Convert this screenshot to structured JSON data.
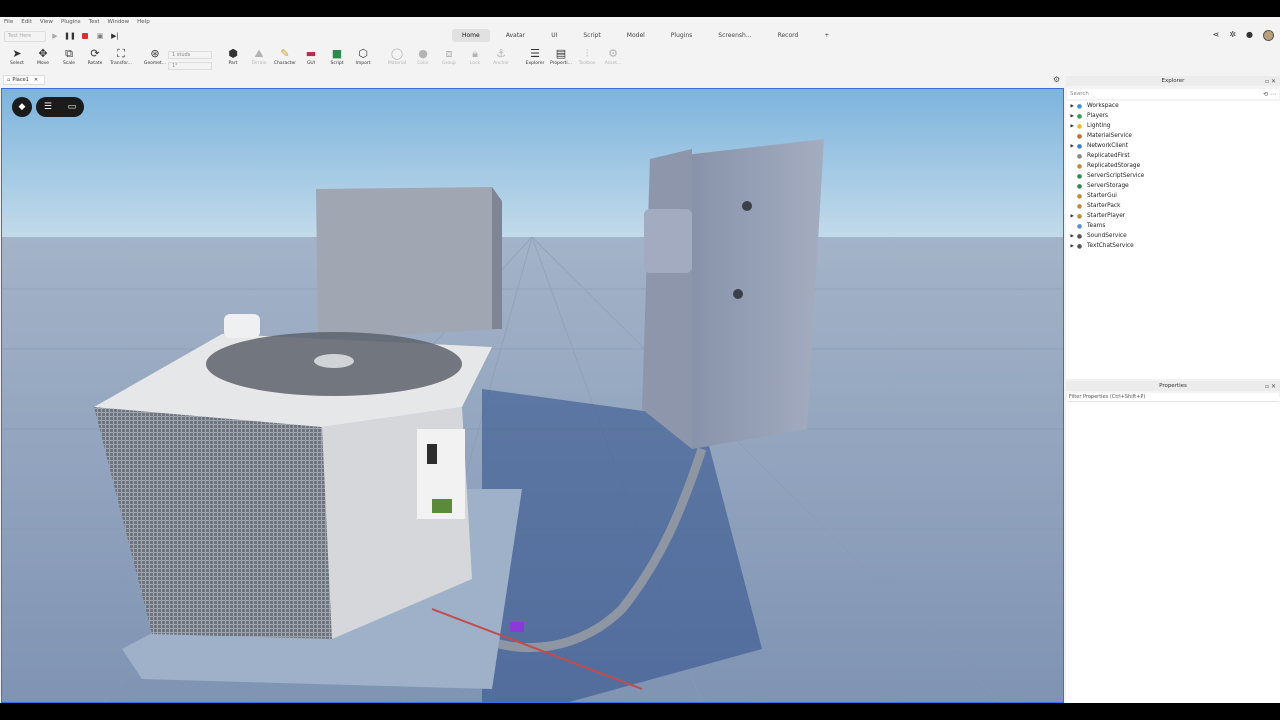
{
  "menu": [
    "File",
    "Edit",
    "View",
    "Plugins",
    "Test",
    "Window",
    "Help"
  ],
  "test_mode": {
    "label": "Test Here"
  },
  "ribbon_tabs": [
    {
      "label": "Home",
      "active": true
    },
    {
      "label": "Avatar"
    },
    {
      "label": "UI"
    },
    {
      "label": "Script"
    },
    {
      "label": "Model"
    },
    {
      "label": "Plugins"
    },
    {
      "label": "Screensh..."
    },
    {
      "label": "Record"
    },
    {
      "label": "+"
    }
  ],
  "toolbar": {
    "select": "Select",
    "move": "Move",
    "scale": "Scale",
    "rotate": "Rotate",
    "transform": "Transfor...",
    "geometry": "Geomet...",
    "studs": "1 studs",
    "degrees": "1°",
    "part": "Part",
    "terrain": "Terrain",
    "character": "Character",
    "gui": "GUI",
    "script": "Script",
    "import": "Import",
    "material": "Material",
    "color": "Color",
    "group": "Group",
    "lock": "Lock",
    "anchor": "Anchor",
    "explorer": "Explorer",
    "properties": "Properti...",
    "toolbox": "Toolbox",
    "asset": "Asset..."
  },
  "doc_tab": {
    "label": "Place1"
  },
  "explorer": {
    "title": "Explorer",
    "search_placeholder": "Search",
    "items": [
      {
        "name": "Workspace",
        "expandable": true,
        "icon_color": "#3d8fd6"
      },
      {
        "name": "Players",
        "expandable": true,
        "icon_color": "#2f9e5a"
      },
      {
        "name": "Lighting",
        "expandable": true,
        "icon_color": "#e8b92c"
      },
      {
        "name": "MaterialService",
        "expandable": false,
        "icon_color": "#c06d2b"
      },
      {
        "name": "NetworkClient",
        "expandable": true,
        "icon_color": "#3a7bd5"
      },
      {
        "name": "ReplicatedFirst",
        "expandable": false,
        "icon_color": "#888888"
      },
      {
        "name": "ReplicatedStorage",
        "expandable": false,
        "icon_color": "#c08a3a"
      },
      {
        "name": "ServerScriptService",
        "expandable": false,
        "icon_color": "#2f8a4f"
      },
      {
        "name": "ServerStorage",
        "expandable": false,
        "icon_color": "#2f8a4f"
      },
      {
        "name": "StarterGui",
        "expandable": false,
        "icon_color": "#c08a3a"
      },
      {
        "name": "StarterPack",
        "expandable": false,
        "icon_color": "#c08a3a"
      },
      {
        "name": "StarterPlayer",
        "expandable": true,
        "icon_color": "#c08a3a"
      },
      {
        "name": "Teams",
        "expandable": false,
        "icon_color": "#5a8fd6"
      },
      {
        "name": "SoundService",
        "expandable": true,
        "icon_color": "#555555"
      },
      {
        "name": "TextChatService",
        "expandable": true,
        "icon_color": "#555555"
      }
    ]
  },
  "properties": {
    "title": "Properties",
    "filter_placeholder": "Filter Properties (Ctrl+Shift+P)"
  }
}
